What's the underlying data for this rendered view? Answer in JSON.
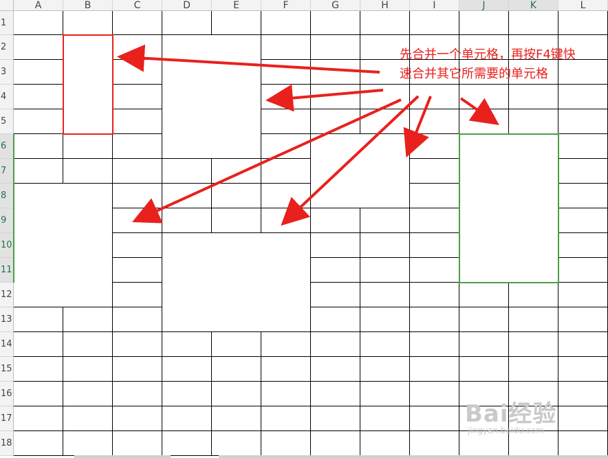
{
  "sheet": {
    "columns": [
      "A",
      "B",
      "C",
      "D",
      "E",
      "F",
      "G",
      "H",
      "I",
      "J",
      "K",
      "L"
    ],
    "rows": [
      "1",
      "2",
      "3",
      "4",
      "5",
      "6",
      "7",
      "8",
      "9",
      "10",
      "11",
      "12",
      "13",
      "14",
      "15",
      "16",
      "17",
      "18"
    ],
    "active_columns": [
      "J",
      "K"
    ],
    "active_rows": [
      "6",
      "7",
      "8",
      "9",
      "10",
      "11"
    ]
  },
  "annotation": {
    "line1": "先合并一个单元格，再按F4键快",
    "line2": "速合并其它所需要的单元格",
    "color": "#e8211d"
  },
  "highlight_colors": {
    "first_merge": "#e8211d",
    "target_merge": "#4a9e43"
  },
  "watermark": {
    "logo": "Bai经验",
    "url": "jingyan.baidu.com"
  }
}
